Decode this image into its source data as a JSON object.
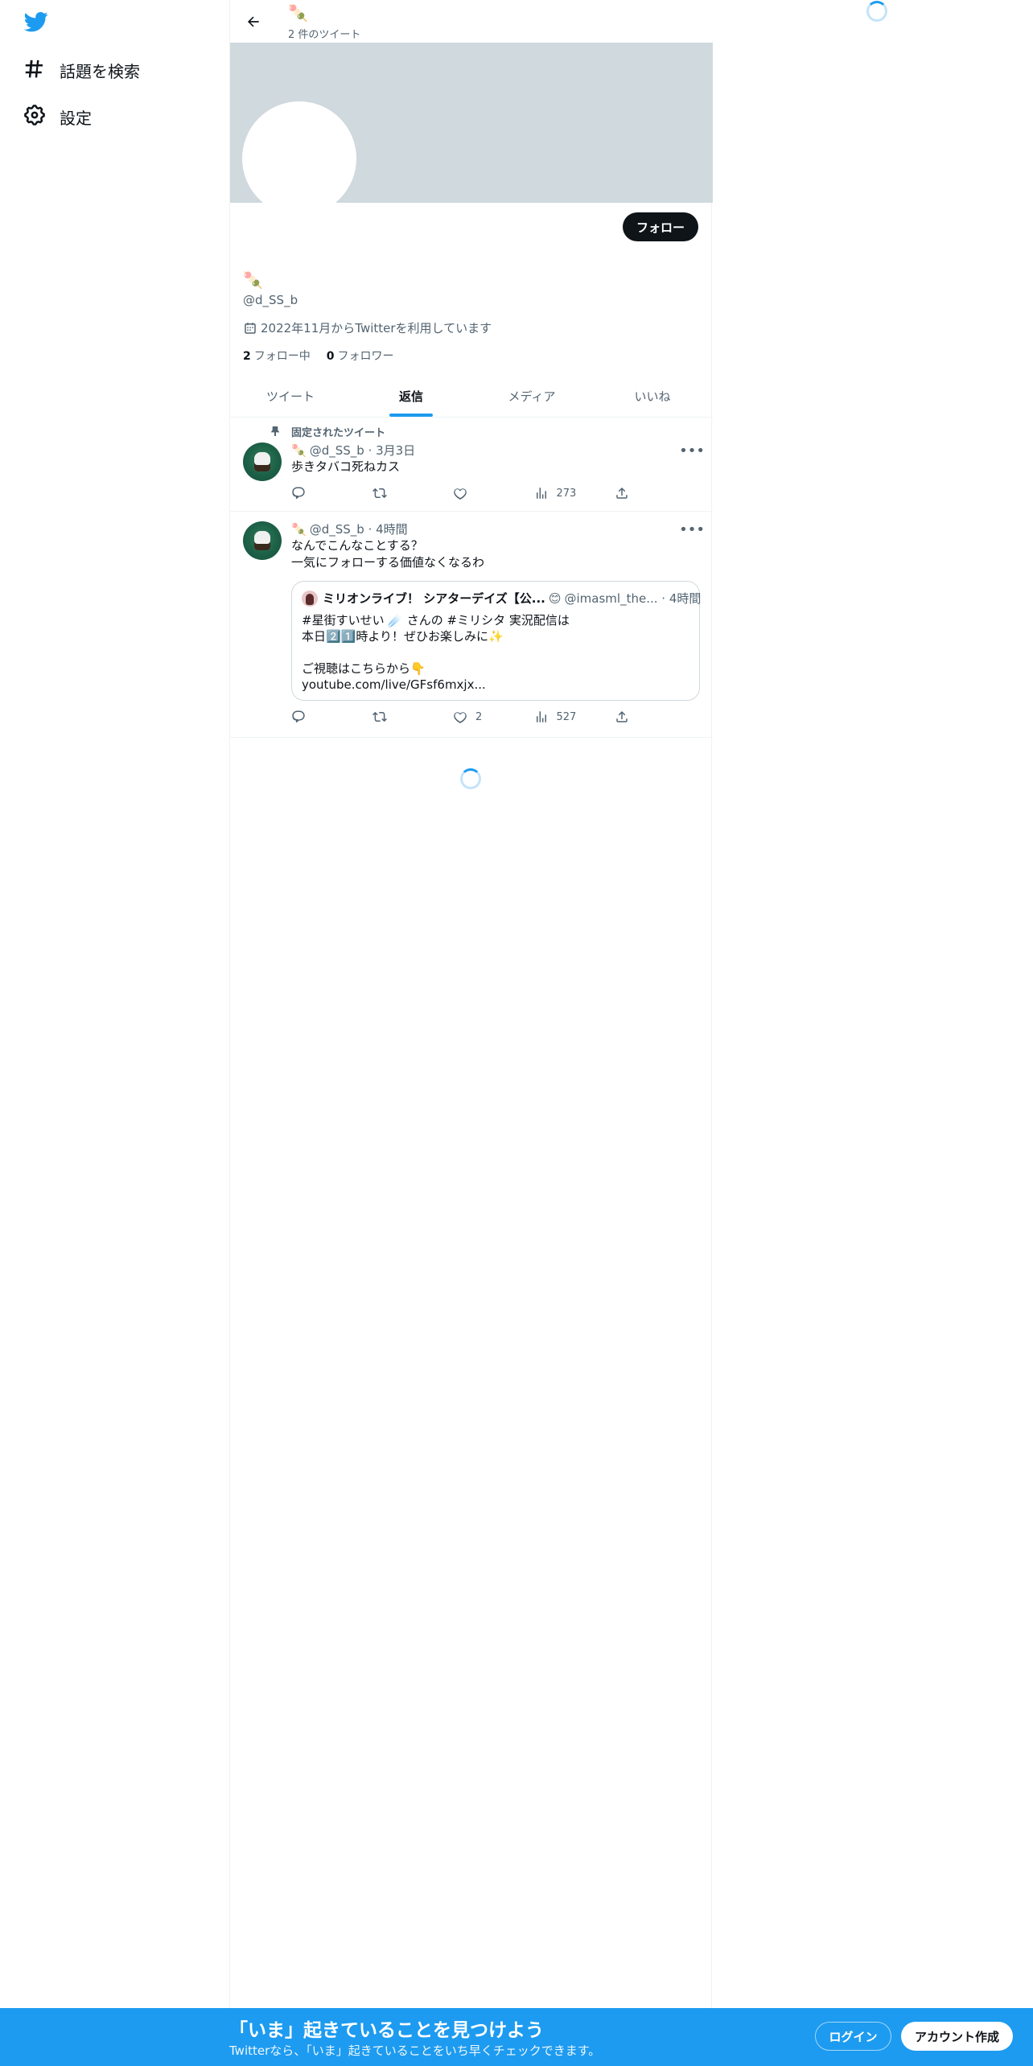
{
  "nav": {
    "items": [
      {
        "label": "話題を検索",
        "icon": "hashtag-icon"
      },
      {
        "label": "設定",
        "icon": "gear-icon"
      }
    ]
  },
  "header": {
    "name": "🍡",
    "tweet_count": "2 件のツイート"
  },
  "profile": {
    "name": "🍡",
    "handle": "@d_SS_b",
    "joined": "2022年11月からTwitterを利用しています",
    "following_count": "2",
    "following_label": "フォロー中",
    "followers_count": "0",
    "followers_label": "フォロワー",
    "follow_button": "フォロー"
  },
  "tabs": [
    {
      "label": "ツイート",
      "active": false
    },
    {
      "label": "返信",
      "active": true
    },
    {
      "label": "メディア",
      "active": false
    },
    {
      "label": "いいね",
      "active": false
    }
  ],
  "tweets": [
    {
      "pinned_label": "固定されたツイート",
      "name": "🍡",
      "handle": "@d_SS_b",
      "time": "· 3月3日",
      "text": "歩きタバコ死ねカス",
      "replies": "",
      "retweets": "",
      "likes": "",
      "views": "273"
    },
    {
      "name": "🍡",
      "handle": "@d_SS_b",
      "time": "· 4時間",
      "text": "なんでこんなことする？\n一気にフォローする価値なくなるわ",
      "quote": {
        "name": "ミリオンライブ！ シアターデイズ【公...",
        "badge": "😊",
        "handle": "@imasml_the...",
        "time": "· 4時間",
        "text": "#星街すいせい ☄️ さんの #ミリシタ 実況配信は\n本日2️⃣1️⃣時より！ぜひお楽しみに✨\n\nご視聴はこちらから👇\nyoutube.com/live/GFsf6mxjx..."
      },
      "replies": "",
      "retweets": "",
      "likes": "2",
      "views": "527"
    }
  ],
  "bottom_bar": {
    "title": "「いま」起きていることを見つけよう",
    "subtitle": "Twitterなら、「いま」起きていることをいち早くチェックできます。",
    "login": "ログイン",
    "signup": "アカウント作成"
  },
  "colors": {
    "accent": "#1d9bf0",
    "banner": "#cfd9de",
    "text": "#0f1419",
    "secondary": "#536471"
  }
}
